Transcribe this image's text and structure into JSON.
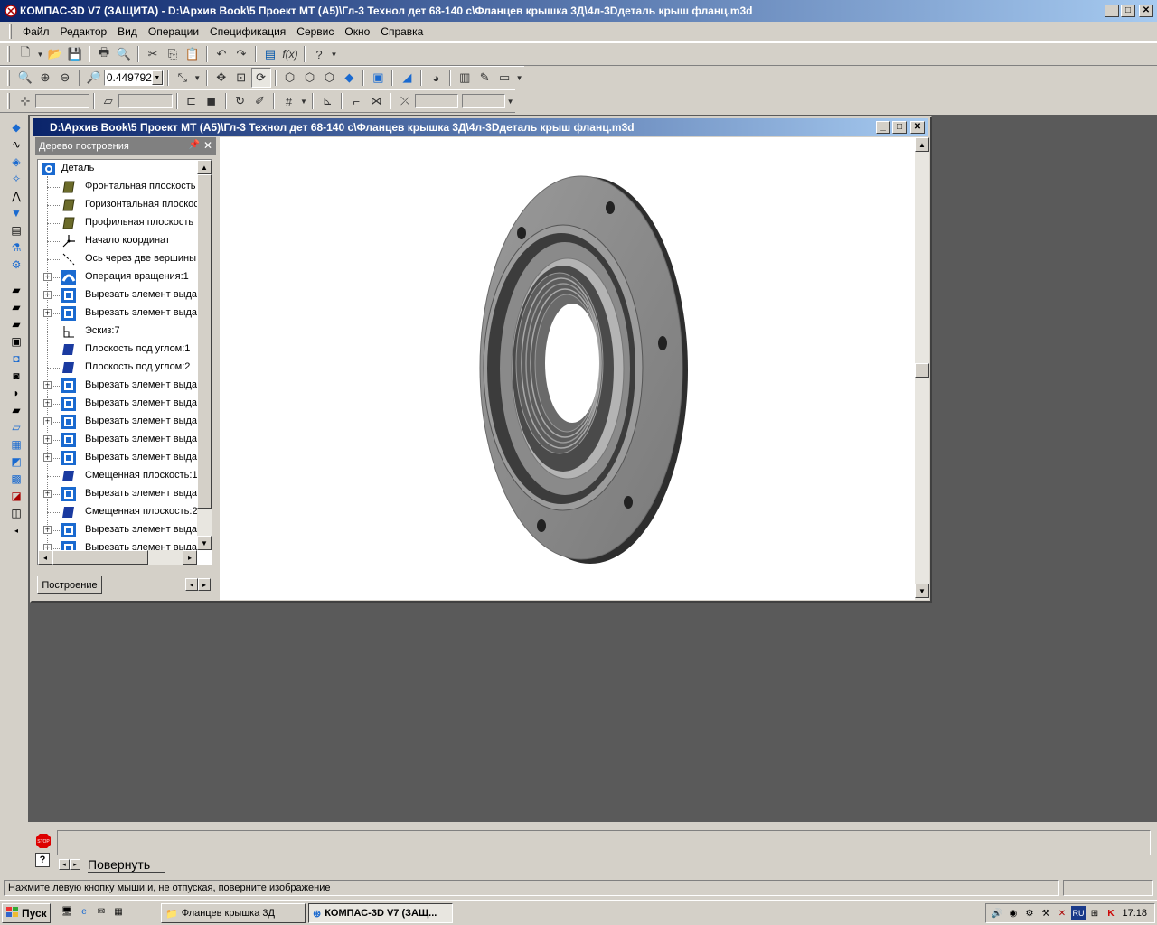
{
  "app": {
    "title": "КОМПАС-3D V7 (ЗАЩИТА) - D:\\Архив Book\\5 Проект МТ (А5)\\Гл-3 Технол  дет 68-140 с\\Фланцев крышка 3Д\\4л-3Dдеталь  крыш фланц.m3d"
  },
  "menu": [
    "Файл",
    "Редактор",
    "Вид",
    "Операции",
    "Спецификация",
    "Сервис",
    "Окно",
    "Справка"
  ],
  "view_toolbar": {
    "zoom_value": "0.449792"
  },
  "document": {
    "title": "D:\\Архив Book\\5 Проект МТ (А5)\\Гл-3 Технол  дет 68-140 с\\Фланцев крышка 3Д\\4л-3Dдеталь  крыш фланц.m3d"
  },
  "tree": {
    "header": "Дерево построения",
    "root": "Деталь",
    "items": [
      {
        "label": "Фронтальная плоскость",
        "icon": "plane-icon",
        "expandable": false
      },
      {
        "label": "Горизонтальная плоскос",
        "icon": "plane-icon",
        "expandable": false
      },
      {
        "label": "Профильная плоскость",
        "icon": "plane-icon",
        "expandable": false
      },
      {
        "label": "Начало координат",
        "icon": "origin-icon",
        "expandable": false
      },
      {
        "label": "Ось через две вершины:",
        "icon": "axis-icon",
        "expandable": false
      },
      {
        "label": "Операция вращения:1",
        "icon": "revolve-icon",
        "expandable": true
      },
      {
        "label": "Вырезать элемент выдав",
        "icon": "extrude-cut-icon",
        "expandable": true
      },
      {
        "label": "Вырезать элемент выдав",
        "icon": "extrude-cut-icon",
        "expandable": true
      },
      {
        "label": "Эскиз:7",
        "icon": "sketch-icon",
        "expandable": false
      },
      {
        "label": "Плоскость под углом:1",
        "icon": "angle-plane-icon",
        "expandable": false
      },
      {
        "label": "Плоскость под углом:2",
        "icon": "angle-plane-icon",
        "expandable": false
      },
      {
        "label": "Вырезать элемент выдав",
        "icon": "extrude-cut-icon",
        "expandable": true
      },
      {
        "label": "Вырезать элемент выдав",
        "icon": "extrude-cut-icon",
        "expandable": true
      },
      {
        "label": "Вырезать элемент выдав",
        "icon": "extrude-cut-icon",
        "expandable": true
      },
      {
        "label": "Вырезать элемент выдав",
        "icon": "extrude-cut-icon",
        "expandable": true
      },
      {
        "label": "Вырезать элемент выдав",
        "icon": "extrude-cut-icon",
        "expandable": true
      },
      {
        "label": "Смещенная плоскость:1",
        "icon": "offset-plane-icon",
        "expandable": false
      },
      {
        "label": "Вырезать элемент выдав",
        "icon": "extrude-cut-icon",
        "expandable": true
      },
      {
        "label": "Смещенная плоскость:2",
        "icon": "offset-plane-icon",
        "expandable": false
      },
      {
        "label": "Вырезать элемент выдав",
        "icon": "extrude-cut-icon",
        "expandable": true
      },
      {
        "label": "Вырезать элемент выдав",
        "icon": "extrude-cut-icon",
        "expandable": true
      }
    ],
    "tab": "Построение"
  },
  "command_panel": {
    "tab": "Повернуть"
  },
  "status": {
    "message": "Нажмите левую кнопку мыши и, не отпуская, поверните изображение"
  },
  "taskbar": {
    "start": "Пуск",
    "tasks": [
      "Фланцев крышка 3Д",
      "КОМПАС-3D V7 (ЗАЩ..."
    ],
    "clock": "17:18",
    "lang": "RU"
  },
  "colors": {
    "titlebar_start": "#0a246a",
    "titlebar_end": "#a6caf0",
    "mdi_background": "#5a5a5a",
    "part_shade": "#8c8c8c"
  }
}
